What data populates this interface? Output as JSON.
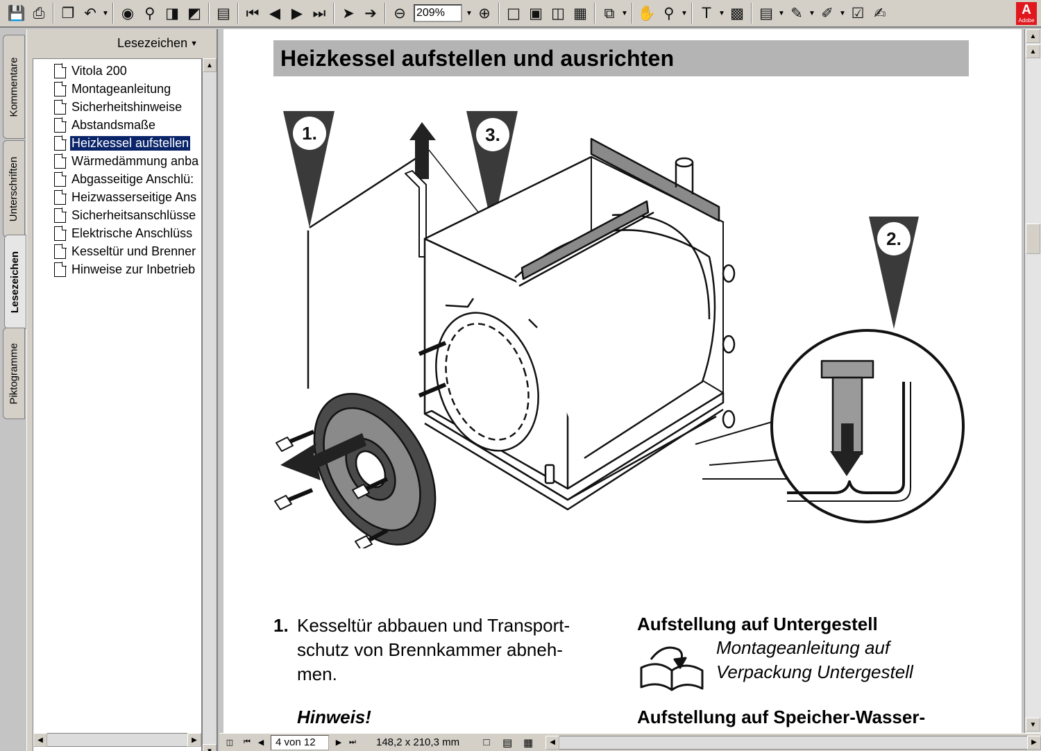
{
  "toolbar": {
    "zoom_value": "209%",
    "adobe_logo_text": "Adobe",
    "icons": [
      "save-icon",
      "print-icon",
      "copy-icon",
      "undo-icon",
      "find-icon",
      "search-icon",
      "page-back-icon",
      "page-forward-icon",
      "show-navigation-icon",
      "first-page-icon",
      "previous-page-icon",
      "next-page-icon",
      "last-page-icon",
      "previous-view-icon",
      "next-view-icon",
      "zoom-out-icon",
      "zoom-in-icon",
      "actual-size-icon",
      "fit-page-icon",
      "fit-width-icon",
      "fit-visible-icon",
      "rotate-icon",
      "hand-tool-icon",
      "zoom-tool-icon",
      "text-select-icon",
      "graphics-select-icon",
      "note-tool-icon",
      "pencil-tool-icon",
      "highlight-tool-icon",
      "spellcheck-icon",
      "sign-icon"
    ]
  },
  "vtabs": {
    "comments": "Kommentare",
    "signatures": "Unterschriften",
    "bookmarks": "Lesezeichen",
    "thumbnails": "Piktogramme"
  },
  "panel": {
    "title": "Lesezeichen",
    "bookmarks": [
      {
        "label": "Vitola 200"
      },
      {
        "label": "Montageanleitung"
      },
      {
        "label": "Sicherheitshinweise"
      },
      {
        "label": "Abstandsmaße"
      },
      {
        "label": "Heizkessel aufstellen"
      },
      {
        "label": "Wärmedämmung anba"
      },
      {
        "label": "Abgasseitige Anschlü:"
      },
      {
        "label": "Heizwasserseitige Ans"
      },
      {
        "label": "Sicherheitsanschlüsse"
      },
      {
        "label": "Elektrische Anschlüss"
      },
      {
        "label": "Kesseltür und Brenner"
      },
      {
        "label": "Hinweise zur Inbetrieb"
      }
    ],
    "selected_index": 4
  },
  "page": {
    "title": "Heizkessel aufstellen und ausrichten",
    "callouts": [
      "1.",
      "3.",
      "2."
    ],
    "step1_number": "1.",
    "step1_text_line1": "Kesseltür abbauen und Transport-",
    "step1_text_line2": "schutz von Brennkammer abneh-",
    "step1_text_line3": "men.",
    "hint": "Hinweis!",
    "right_heading": "Aufstellung auf Untergestell",
    "right_ref_line1": "Montageanleitung auf",
    "right_ref_line2": "Verpackung Untergestell",
    "right_heading2": "Aufstellung auf Speicher-Wasser-"
  },
  "statusbar": {
    "page_field": "4 von 12",
    "page_size": "148,2 x 210,3 mm"
  }
}
